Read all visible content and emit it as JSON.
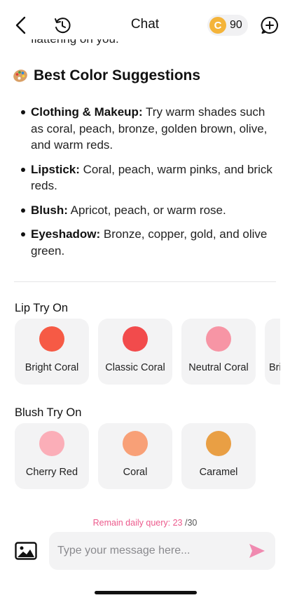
{
  "header": {
    "title": "Chat",
    "coins": "90",
    "coin_symbol": "C"
  },
  "previous_text_fragment": "flattering on you.",
  "suggestions": {
    "heading": "Best Color Suggestions",
    "heading_icon": "artist-palette-icon",
    "items": [
      {
        "label": "Clothing & Makeup:",
        "text": " Try warm shades such as coral, peach, bronze, golden brown, olive, and warm reds."
      },
      {
        "label": "Lipstick:",
        "text": " Coral, peach, warm pinks, and brick reds."
      },
      {
        "label": "Blush:",
        "text": " Apricot, peach, or warm rose."
      },
      {
        "label": "Eyeshadow:",
        "text": " Bronze, copper, gold, and olive green."
      }
    ]
  },
  "lip_try_on": {
    "title": "Lip Try On",
    "swatches": [
      {
        "label": "Bright Coral",
        "color": "#f65a45"
      },
      {
        "label": "Classic Coral",
        "color": "#f24b4c"
      },
      {
        "label": "Neutral Coral",
        "color": "#f795a5"
      },
      {
        "label": "Brig",
        "color": "#f5f5f5"
      }
    ]
  },
  "blush_try_on": {
    "title": "Blush Try On",
    "swatches": [
      {
        "label": "Cherry Red",
        "color": "#fbaeb8"
      },
      {
        "label": "Coral",
        "color": "#f8a077"
      },
      {
        "label": "Caramel",
        "color": "#e99f44"
      }
    ]
  },
  "footer": {
    "quota_label": "Remain daily query: 23",
    "quota_total": " /30",
    "input_placeholder": "Type your message here...",
    "accent_color": "#ec5a8c"
  }
}
